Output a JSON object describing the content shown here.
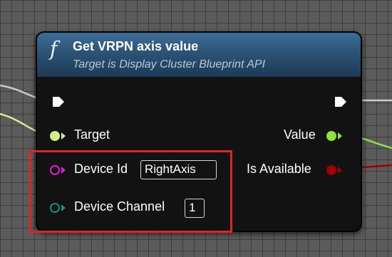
{
  "node": {
    "function_icon": "f",
    "title": "Get VRPN axis value",
    "subtitle": "Target is Display Cluster Blueprint API"
  },
  "inputs": [
    {
      "label": "Target",
      "pin_type": "object",
      "color": "#d8ec8c"
    },
    {
      "label": "Device Id",
      "pin_type": "string",
      "color": "#e020d0",
      "value": "RightAxis"
    },
    {
      "label": "Device Channel",
      "pin_type": "integer",
      "color": "#1a8c8c",
      "value": "1"
    }
  ],
  "outputs": [
    {
      "label": "Value",
      "pin_type": "float",
      "color": "#8ee044"
    },
    {
      "label": "Is Available",
      "pin_type": "boolean",
      "color": "#a00000"
    }
  ],
  "colors": {
    "header": "#2c5376",
    "node_body": "#121212",
    "highlight": "#e52222",
    "exec_pin": "#ffffff"
  },
  "icons": {
    "function": "function-icon",
    "exec_in": "exec-in-pin-icon",
    "exec_out": "exec-out-pin-icon"
  }
}
